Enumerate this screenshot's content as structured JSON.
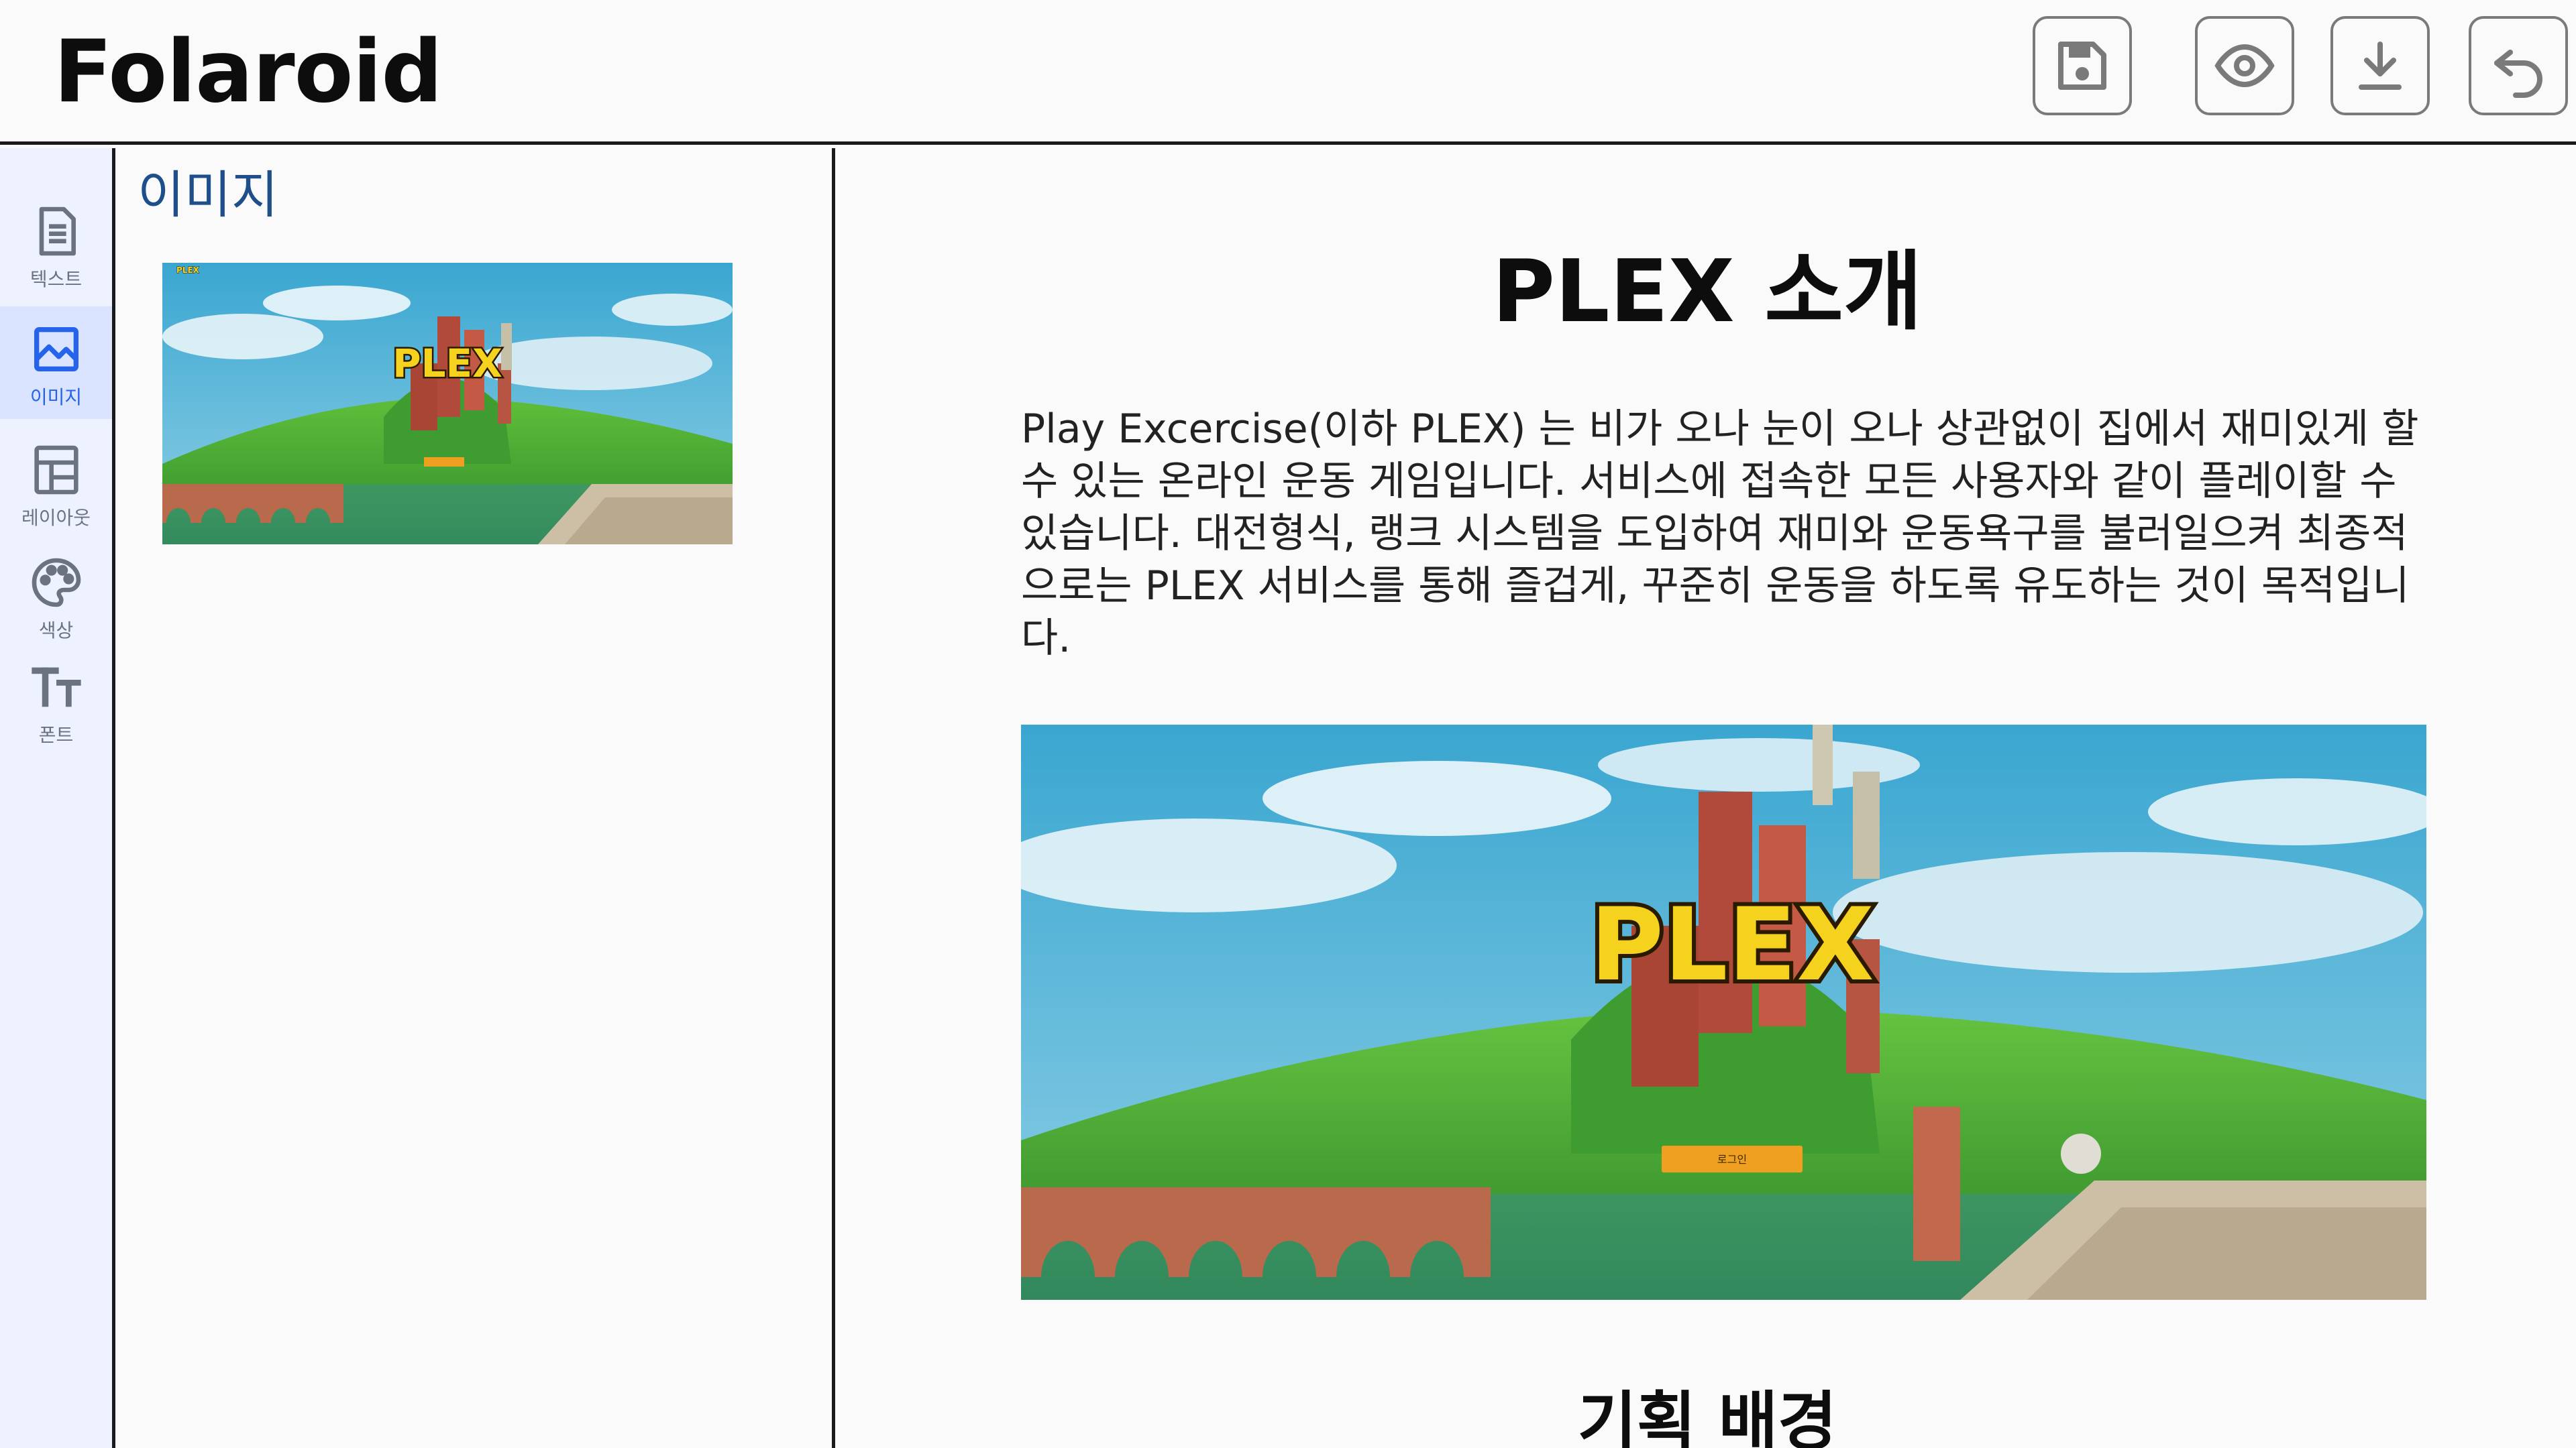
{
  "app": {
    "title": "Folaroid"
  },
  "header": {
    "buttons": [
      {
        "name": "save",
        "icon": "save-icon"
      },
      {
        "name": "preview",
        "icon": "eye-icon"
      },
      {
        "name": "download",
        "icon": "download-icon"
      },
      {
        "name": "back",
        "icon": "undo-arrow-icon"
      }
    ]
  },
  "sidebar": {
    "items": [
      {
        "label": "텍스트",
        "icon": "document-icon",
        "active": false
      },
      {
        "label": "이미지",
        "icon": "image-icon",
        "active": true
      },
      {
        "label": "레이아웃",
        "icon": "layout-icon",
        "active": false
      },
      {
        "label": "색상",
        "icon": "palette-icon",
        "active": false
      },
      {
        "label": "폰트",
        "icon": "font-icon",
        "active": false
      }
    ]
  },
  "panel": {
    "title": "이미지",
    "thumbnail": {
      "logo_text": "PLEX",
      "small_label": "PLEX"
    }
  },
  "document": {
    "title": "PLEX 소개",
    "body": "Play Excercise(이하 PLEX) 는 비가 오나 눈이 오나 상관없이 집에서 재미있게 할 수 있는 온라인 운동 게임입니다. 서비스에 접속한 모든 사용자와 같이 플레이할 수 있습니다. 대전형식, 랭크 시스템을 도입하여 재미와 운동욕구를 불러일으켜 최종적으로는 PLEX 서비스를 통해 즐겁게, 꾸준히 운동을 하도록 유도하는 것이 목적입니다.",
    "image": {
      "logo_text": "PLEX",
      "button_text": "로그인"
    },
    "subtitle": "기획 배경"
  },
  "colors": {
    "accent": "#2563eb",
    "panel_title": "#1e4f8a",
    "rail_bg": "#eef2ff",
    "rail_active_bg": "#dbe4ff"
  }
}
